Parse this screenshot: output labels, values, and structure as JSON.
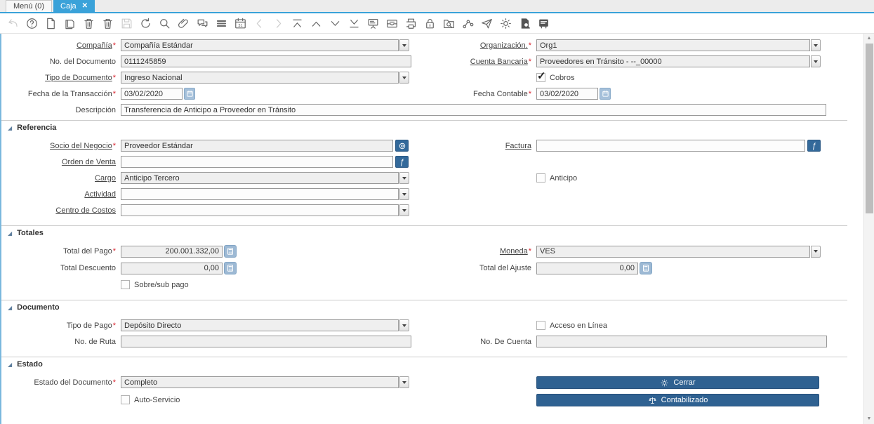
{
  "colors": {
    "accent": "#3aa2d9",
    "action_button": "#2f6191",
    "lookup_button": "#33699a"
  },
  "tabs": {
    "menu": "Menú (0)",
    "caja": "Caja",
    "close_icon": "✕"
  },
  "toolbar": {
    "calendar_day": "31",
    "icons": [
      "undo-icon",
      "help-icon",
      "new-record-icon",
      "copy-record-icon",
      "delete-record-icon",
      "delete-selection-icon",
      "save-icon",
      "refresh-icon",
      "find-icon",
      "attachment-icon",
      "chat-icon",
      "grid-toggle-icon",
      "calendar-icon",
      "parent-record-icon",
      "detail-record-icon",
      "first-record-icon",
      "previous-record-icon",
      "next-record-icon",
      "last-record-icon",
      "report-icon",
      "archive-icon",
      "print-icon",
      "lock-icon",
      "zoom-across-icon",
      "workflow-icon",
      "export-icon",
      "customize-icon",
      "document-search-icon",
      "quick-form-icon"
    ]
  },
  "marks": {
    "required": "*",
    "check": "✓",
    "section_arrow": "◢",
    "scroll_up": "▲",
    "scroll_down": "▼",
    "lookup_doc": "ƒ"
  },
  "sections": {
    "referencia": "Referencia",
    "totales": "Totales",
    "documento": "Documento",
    "estado": "Estado"
  },
  "fields": {
    "compania": {
      "label": "Compañía",
      "value": "Compañía Estándar"
    },
    "organizacion": {
      "label": "Organización.",
      "value": "Org1"
    },
    "no_documento": {
      "label": "No. del Documento",
      "value": "0111245859"
    },
    "cuenta_bancaria": {
      "label": "Cuenta Bancaria",
      "value": "Proveedores en Tránsito - --_00000"
    },
    "tipo_documento": {
      "label": "Tipo de Documento",
      "value": "Ingreso Nacional"
    },
    "cobros": {
      "label": "Cobros",
      "checked": true
    },
    "fecha_transaccion": {
      "label": "Fecha de la Transacción",
      "value": "03/02/2020"
    },
    "fecha_contable": {
      "label": "Fecha Contable",
      "value": "03/02/2020"
    },
    "descripcion": {
      "label": "Descripción",
      "value": "Transferencia de Anticipo a Proveedor en Tránsito"
    },
    "socio_negocio": {
      "label": "Socio del Negocio",
      "value": "Proveedor Estándar"
    },
    "factura": {
      "label": "Factura",
      "value": ""
    },
    "orden_venta": {
      "label": "Orden de Venta",
      "value": ""
    },
    "cargo": {
      "label": "Cargo",
      "value": "Anticipo Tercero"
    },
    "anticipo": {
      "label": "Anticipo",
      "checked": false
    },
    "actividad": {
      "label": "Actividad",
      "value": ""
    },
    "centro_costos": {
      "label": "Centro de Costos",
      "value": ""
    },
    "total_pago": {
      "label": "Total del Pago",
      "value": "200.001.332,00"
    },
    "moneda": {
      "label": "Moneda",
      "value": "VES"
    },
    "total_descuento": {
      "label": "Total Descuento",
      "value": "0,00"
    },
    "total_ajuste": {
      "label": "Total del Ajuste",
      "value": "0,00"
    },
    "sobre_sub_pago": {
      "label": "Sobre/sub pago",
      "checked": false
    },
    "tipo_pago": {
      "label": "Tipo de Pago",
      "value": "Depósito Directo"
    },
    "acceso_linea": {
      "label": "Acceso en Línea",
      "checked": false
    },
    "no_ruta": {
      "label": "No. de Ruta",
      "value": ""
    },
    "no_cuenta": {
      "label": "No. De Cuenta",
      "value": ""
    },
    "estado_documento": {
      "label": "Estado del Documento",
      "value": "Completo"
    },
    "auto_servicio": {
      "label": "Auto-Servicio",
      "checked": false
    }
  },
  "buttons": {
    "cerrar": "Cerrar",
    "contabilizado": "Contabilizado"
  }
}
